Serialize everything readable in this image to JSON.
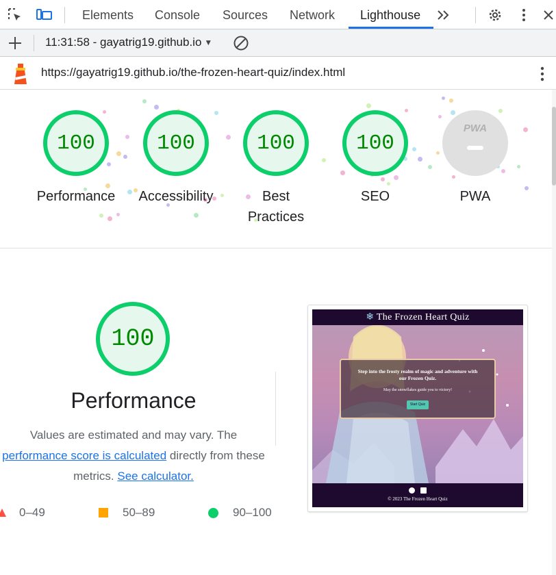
{
  "devtools": {
    "tabs": [
      {
        "label": "Elements",
        "active": false
      },
      {
        "label": "Console",
        "active": false
      },
      {
        "label": "Sources",
        "active": false
      },
      {
        "label": "Network",
        "active": false
      },
      {
        "label": "Lighthouse",
        "active": true
      }
    ],
    "more_tabs_icon": "chevrons-right-icon",
    "settings_icon": "gear-icon",
    "menu_icon": "kebab-menu-icon",
    "close_icon": "close-icon",
    "accent_color": "#1a73e8"
  },
  "report_bar": {
    "add_icon": "plus-icon",
    "report_selector": "11:31:58 - gayatrig19.github.io",
    "clear_icon": "block-icon"
  },
  "url_bar": {
    "icon": "lighthouse-icon",
    "url": "https://gayatrig19.github.io/the-frozen-heart-quiz/index.html",
    "menu_icon": "kebab-menu-icon"
  },
  "scores": [
    {
      "label": "Performance",
      "score": "100"
    },
    {
      "label": "Accessibility",
      "score": "100"
    },
    {
      "label": "Best",
      "label2": "Practices",
      "score": "100"
    },
    {
      "label": "SEO",
      "score": "100"
    },
    {
      "label": "PWA",
      "badge_text": "PWA"
    }
  ],
  "score_color": "#0cce6b",
  "performance": {
    "score": "100",
    "title": "Performance",
    "desc_part1": "Values are estimated and may vary. The",
    "desc_link": "performance score is calculated",
    "desc_part2": "directly from these metrics.",
    "calculator_link": "See calculator.",
    "legend": [
      {
        "range": "0–49",
        "color": "#ff4e42"
      },
      {
        "range": "50–89",
        "color": "#ffa400"
      },
      {
        "range": "90–100",
        "color": "#0cce6b"
      }
    ]
  },
  "screenshot": {
    "header_title": "The Frozen Heart Quiz",
    "header_icon": "snowflake-icon",
    "card_line1": "Step into the frosty realm of magic and adventure with",
    "card_line2": "our Frozen Quiz.",
    "card_sub": "May the snowflakes guide you to victory!",
    "start_button": "Start Quiz",
    "footer_icons": [
      "github-icon",
      "linkedin-icon"
    ],
    "footer_text": "© 2023 The Frozen Heart Quiz"
  }
}
